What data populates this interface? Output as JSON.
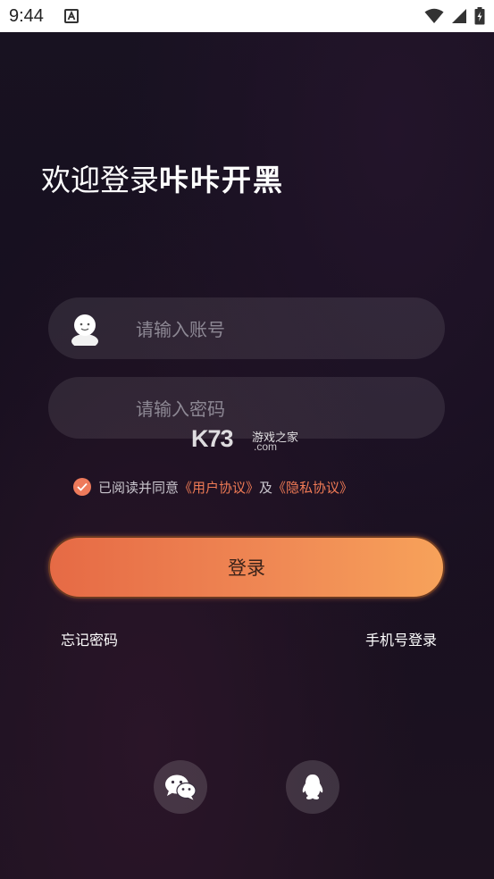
{
  "status_bar": {
    "time": "9:44",
    "icons": [
      "app-a-icon",
      "wifi-icon",
      "signal-icon",
      "battery-icon"
    ]
  },
  "welcome": {
    "prefix": "欢迎登录",
    "brand": "咔咔开黑"
  },
  "account_field": {
    "placeholder": "请输入账号",
    "value": ""
  },
  "password_field": {
    "placeholder": "请输入密码",
    "value": ""
  },
  "watermark": {
    "logo": "K73",
    "site": "游戏之家",
    "domain": ".com"
  },
  "agreement": {
    "checked": true,
    "text": "已阅读并同意",
    "user_agreement": "《用户协议》",
    "and": "及",
    "privacy_agreement": "《隐私协议》"
  },
  "login_button": {
    "label": "登录"
  },
  "links": {
    "forgot_password": "忘记密码",
    "phone_login": "手机号登录"
  },
  "social_login": [
    {
      "icon": "wechat-icon"
    },
    {
      "icon": "qq-icon"
    }
  ],
  "colors": {
    "accent": "#ef7a55",
    "button_start": "#e66a45",
    "button_end": "#f7a25a",
    "background": "#181221"
  }
}
